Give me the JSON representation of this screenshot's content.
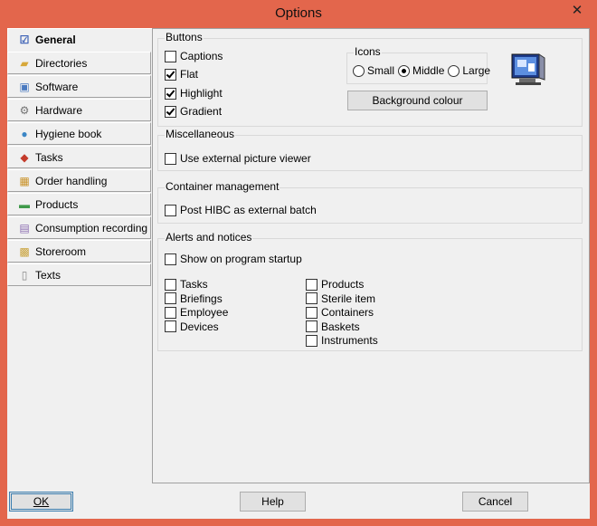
{
  "window": {
    "title": "Options",
    "close_label": "✕"
  },
  "tabs": [
    {
      "label": "General",
      "icon": "checklist-icon",
      "glyph": "☑",
      "color": "#3a5fb5"
    },
    {
      "label": "Directories",
      "icon": "folder-icon",
      "glyph": "▰",
      "color": "#d7a83a"
    },
    {
      "label": "Software",
      "icon": "software-icon",
      "glyph": "▣",
      "color": "#4a7ac0"
    },
    {
      "label": "Hardware",
      "icon": "hardware-icon",
      "glyph": "⚙",
      "color": "#707070"
    },
    {
      "label": "Hygiene book",
      "icon": "globe-icon",
      "glyph": "●",
      "color": "#3b86c5"
    },
    {
      "label": "Tasks",
      "icon": "tasks-icon",
      "glyph": "◆",
      "color": "#c43b2b"
    },
    {
      "label": "Order handling",
      "icon": "box-icon",
      "glyph": "▦",
      "color": "#c99228"
    },
    {
      "label": "Products",
      "icon": "products-icon",
      "glyph": "▬",
      "color": "#3f9a4a"
    },
    {
      "label": "Consumption recording",
      "icon": "consumption-icon",
      "glyph": "▤",
      "color": "#8a6bb0"
    },
    {
      "label": "Storeroom",
      "icon": "storeroom-icon",
      "glyph": "▩",
      "color": "#c9a23a"
    },
    {
      "label": "Texts",
      "icon": "document-icon",
      "glyph": "▯",
      "color": "#888888"
    }
  ],
  "buttons_group": {
    "label": "Buttons",
    "items": [
      {
        "label": "Captions",
        "checked": false
      },
      {
        "label": "Flat",
        "checked": true
      },
      {
        "label": "Highlight",
        "checked": true
      },
      {
        "label": "Gradient",
        "checked": true
      }
    ],
    "icons_label": "Icons",
    "icon_sizes": [
      {
        "label": "Small",
        "selected": false
      },
      {
        "label": "Middle",
        "selected": true
      },
      {
        "label": "Large",
        "selected": false
      }
    ],
    "background_button": "Background colour"
  },
  "misc_group": {
    "label": "Miscellaneous",
    "items": [
      {
        "label": "Use external picture viewer",
        "checked": false
      }
    ]
  },
  "container_group": {
    "label": "Container management",
    "items": [
      {
        "label": "Post HIBC as external batch",
        "checked": false
      }
    ]
  },
  "alerts_group": {
    "label": "Alerts and notices",
    "startup": {
      "label": "Show on program startup",
      "checked": false
    },
    "left_items": [
      {
        "label": "Tasks",
        "checked": false
      },
      {
        "label": "Briefings",
        "checked": false
      },
      {
        "label": "Employee",
        "checked": false
      },
      {
        "label": "Devices",
        "checked": false
      }
    ],
    "right_items": [
      {
        "label": "Products",
        "checked": false
      },
      {
        "label": "Sterile item",
        "checked": false
      },
      {
        "label": "Containers",
        "checked": false
      },
      {
        "label": "Baskets",
        "checked": false
      },
      {
        "label": "Instruments",
        "checked": false
      }
    ]
  },
  "footer": {
    "ok": "OK",
    "help": "Help",
    "cancel": "Cancel"
  }
}
